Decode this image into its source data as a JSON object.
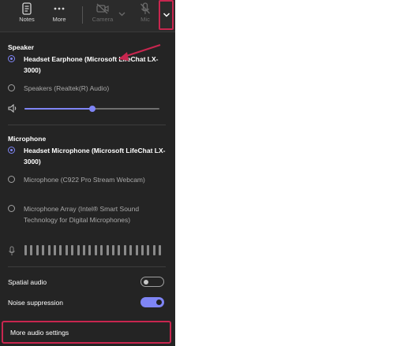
{
  "toolbar": {
    "notes_label": "Notes",
    "more_label": "More",
    "camera_label": "Camera",
    "mic_label": "Mic"
  },
  "speaker": {
    "title": "Speaker",
    "options": [
      {
        "label": "Headset Earphone (Microsoft LifeChat LX-3000)",
        "selected": true
      },
      {
        "label": "Speakers (Realtek(R) Audio)",
        "selected": false
      }
    ],
    "volume_fraction": 0.5
  },
  "microphone": {
    "title": "Microphone",
    "options": [
      {
        "label": "Headset Microphone (Microsoft LifeChat LX-3000)",
        "selected": true
      },
      {
        "label": "Microphone (C922 Pro Stream Webcam)",
        "selected": false
      },
      {
        "label": "Microphone Array (Intel® Smart Sound Technology for Digital Microphones)",
        "selected": false
      }
    ]
  },
  "toggles": {
    "spatial_audio": {
      "label": "Spatial audio",
      "on": false
    },
    "noise_suppression": {
      "label": "Noise suppression",
      "on": true
    }
  },
  "more_audio_settings_label": "More audio settings",
  "colors": {
    "panel_bg": "#242424",
    "accent": "#7f85f5",
    "highlight": "#c8264f"
  },
  "icons": {
    "notes": "notes-icon",
    "more": "more-dots-icon",
    "camera": "camera-off-icon",
    "mic": "mic-off-icon",
    "dropdown": "chevron-down-icon",
    "volume": "speaker-volume-icon",
    "mic_level": "mic-level-icon"
  }
}
